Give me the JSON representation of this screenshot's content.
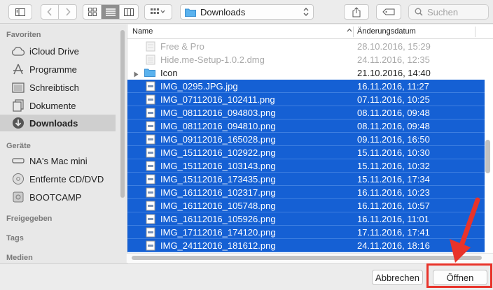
{
  "toolbar": {
    "path_label": "Downloads",
    "search_placeholder": "Suchen",
    "icons": [
      "sidebar-toggle-icon",
      "back-icon",
      "forward-icon",
      "icon-view-icon",
      "list-view-icon",
      "column-view-icon",
      "group-icon",
      "share-icon",
      "tag-icon",
      "search-icon"
    ]
  },
  "sidebar": {
    "favorites_heading": "Favoriten",
    "favorites": [
      {
        "label": "iCloud Drive",
        "icon": "cloud-icon"
      },
      {
        "label": "Programme",
        "icon": "applications-icon"
      },
      {
        "label": "Schreibtisch",
        "icon": "desktop-icon"
      },
      {
        "label": "Dokumente",
        "icon": "documents-icon"
      },
      {
        "label": "Downloads",
        "icon": "downloads-icon",
        "selected": true
      }
    ],
    "devices_heading": "Geräte",
    "devices": [
      {
        "label": "NA's Mac mini",
        "icon": "computer-icon"
      },
      {
        "label": "Entfernte CD/DVD",
        "icon": "disc-icon"
      },
      {
        "label": "BOOTCAMP",
        "icon": "drive-icon"
      }
    ],
    "shared_heading": "Freigegeben",
    "tags_heading": "Tags",
    "media_heading": "Medien"
  },
  "list": {
    "col_name": "Name",
    "col_date": "Änderungsdatum",
    "rows": [
      {
        "name": "Free & Pro",
        "date": "28.10.2016, 15:29",
        "state": "dim",
        "icon": "app-file-icon"
      },
      {
        "name": "Hide.me-Setup-1.0.2.dmg",
        "date": "24.11.2016, 12:35",
        "state": "dim",
        "icon": "dmg-file-icon"
      },
      {
        "name": "Icon",
        "date": "21.10.2016, 14:40",
        "state": "normal",
        "icon": "folder-icon"
      },
      {
        "name": "IMG_0295.JPG.jpg",
        "date": "16.11.2016, 11:27",
        "state": "sel",
        "icon": "image-file-icon"
      },
      {
        "name": "IMG_07112016_102411.png",
        "date": "07.11.2016, 10:25",
        "state": "sel",
        "icon": "image-file-icon"
      },
      {
        "name": "IMG_08112016_094803.png",
        "date": "08.11.2016, 09:48",
        "state": "sel",
        "icon": "image-file-icon"
      },
      {
        "name": "IMG_08112016_094810.png",
        "date": "08.11.2016, 09:48",
        "state": "sel",
        "icon": "image-file-icon"
      },
      {
        "name": "IMG_09112016_165028.png",
        "date": "09.11.2016, 16:50",
        "state": "sel",
        "icon": "image-file-icon"
      },
      {
        "name": "IMG_15112016_102922.png",
        "date": "15.11.2016, 10:30",
        "state": "sel",
        "icon": "image-file-icon"
      },
      {
        "name": "IMG_15112016_103143.png",
        "date": "15.11.2016, 10:32",
        "state": "sel",
        "icon": "image-file-icon"
      },
      {
        "name": "IMG_15112016_173435.png",
        "date": "15.11.2016, 17:34",
        "state": "sel",
        "icon": "image-file-icon"
      },
      {
        "name": "IMG_16112016_102317.png",
        "date": "16.11.2016, 10:23",
        "state": "sel",
        "icon": "image-file-icon"
      },
      {
        "name": "IMG_16112016_105748.png",
        "date": "16.11.2016, 10:57",
        "state": "sel",
        "icon": "image-file-icon"
      },
      {
        "name": "IMG_16112016_105926.png",
        "date": "16.11.2016, 11:01",
        "state": "sel",
        "icon": "image-file-icon"
      },
      {
        "name": "IMG_17112016_174120.png",
        "date": "17.11.2016, 17:41",
        "state": "sel",
        "icon": "image-file-icon"
      },
      {
        "name": "IMG_24112016_181612.png",
        "date": "24.11.2016, 18:16",
        "state": "sel",
        "icon": "image-file-icon"
      }
    ]
  },
  "buttons": {
    "cancel": "Abbrechen",
    "open": "Öffnen"
  },
  "colors": {
    "selection": "#1560d4",
    "highlight": "#e8332a"
  }
}
